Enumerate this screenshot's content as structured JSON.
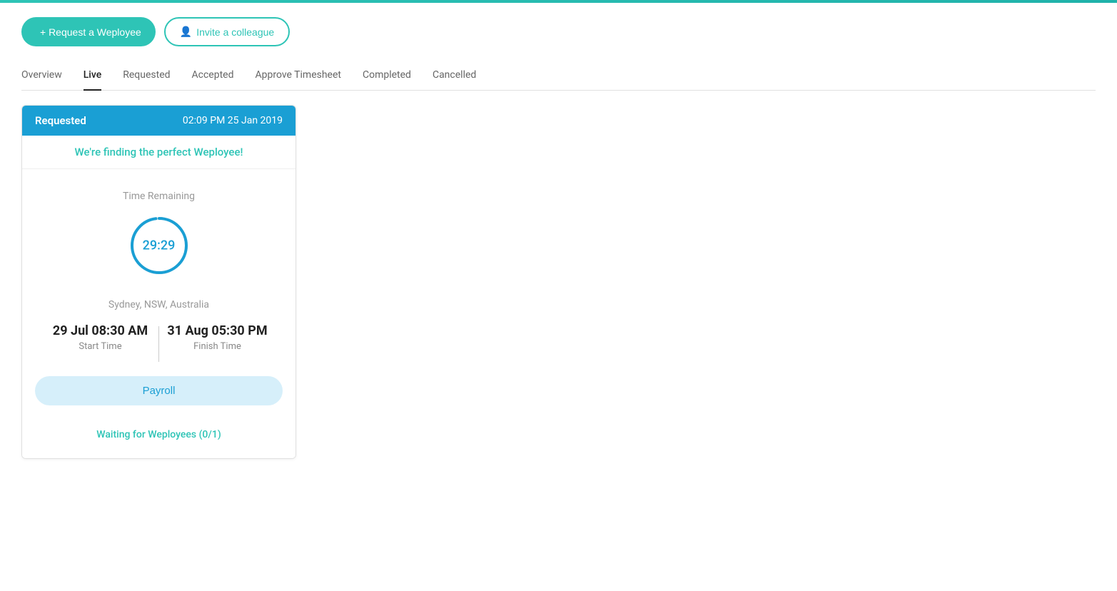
{
  "topBar": {},
  "actionButtons": {
    "requestLabel": "+ Request a Weployee",
    "inviteLabel": "Invite a colleague",
    "inviteIcon": "👤+"
  },
  "tabs": {
    "items": [
      {
        "id": "overview",
        "label": "Overview",
        "active": false
      },
      {
        "id": "live",
        "label": "Live",
        "active": true
      },
      {
        "id": "requested",
        "label": "Requested",
        "active": false
      },
      {
        "id": "accepted",
        "label": "Accepted",
        "active": false
      },
      {
        "id": "approve-timesheet",
        "label": "Approve Timesheet",
        "active": false
      },
      {
        "id": "completed",
        "label": "Completed",
        "active": false
      },
      {
        "id": "cancelled",
        "label": "Cancelled",
        "active": false
      }
    ]
  },
  "card": {
    "header": {
      "status": "Requested",
      "date": "02:09 PM 25 Jan 2019"
    },
    "findingText": "We're finding the perfect Weployee!",
    "timeRemaining": {
      "label": "Time Remaining",
      "value": "29:29"
    },
    "location": "Sydney, NSW, Australia",
    "startTime": {
      "value": "29 Jul 08:30 AM",
      "label": "Start Time"
    },
    "finishTime": {
      "value": "31 Aug 05:30 PM",
      "label": "Finish Time"
    },
    "payrollButton": "Payroll",
    "waitingText": "Waiting for Weployees (0/1)"
  },
  "colors": {
    "teal": "#2ec4b6",
    "blue": "#1a9fd4",
    "activeTabBorder": "#222"
  }
}
